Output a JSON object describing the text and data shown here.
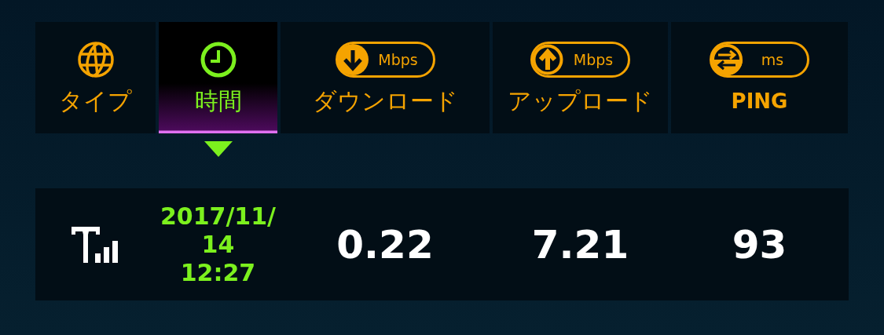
{
  "tabs": [
    {
      "kind": "type",
      "label": "タイプ",
      "selected": false
    },
    {
      "kind": "time",
      "label": "時間",
      "selected": true
    },
    {
      "kind": "download",
      "label": "ダウンロード",
      "unit": "Mbps",
      "selected": false
    },
    {
      "kind": "upload",
      "label": "アップロード",
      "unit": "Mbps",
      "selected": false
    },
    {
      "kind": "ping",
      "label": "PING",
      "unit": "ms",
      "selected": false
    }
  ],
  "result": {
    "time_lines": [
      "2017/11/",
      "14",
      "12:27"
    ],
    "download": "0.22",
    "upload": "7.21",
    "ping": "93"
  }
}
